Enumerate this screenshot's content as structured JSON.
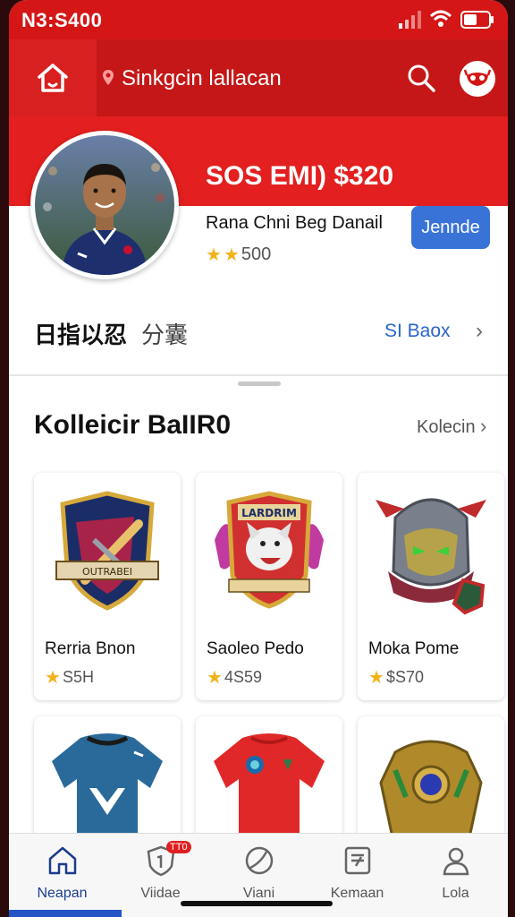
{
  "status_bar": {
    "time": "N3:S400"
  },
  "header": {
    "title": "Sinkgcin lallacan"
  },
  "profile": {
    "title": "SOS EMI) $320",
    "subtitle": "Rana Chni Beg Danail",
    "rating": "500",
    "join_label": "Jennde"
  },
  "section": {
    "label_a": "日指以忍",
    "label_b": "分囊",
    "link": "SI Baox"
  },
  "collection": {
    "title": "Kolleicir BaIIR0",
    "link": "Kolecin",
    "cards": [
      {
        "name": "Rerria Bnon",
        "price": "S5H"
      },
      {
        "name": "Saoleo Pedo",
        "price": "4S59"
      },
      {
        "name": "Moka Pome",
        "price": "$S70"
      }
    ]
  },
  "bottom_nav": {
    "items": [
      {
        "label": "Neapan",
        "icon": "home-icon"
      },
      {
        "label": "Viidae",
        "icon": "shield-icon",
        "badge": "TT0"
      },
      {
        "label": "Viani",
        "icon": "ball-icon"
      },
      {
        "label": "Kemaan",
        "icon": "document-icon"
      },
      {
        "label": "Lola",
        "icon": "profile-icon"
      }
    ]
  },
  "colors": {
    "brand_red": "#d41616",
    "accent_blue": "#3a73d8",
    "star": "#f2b319"
  }
}
